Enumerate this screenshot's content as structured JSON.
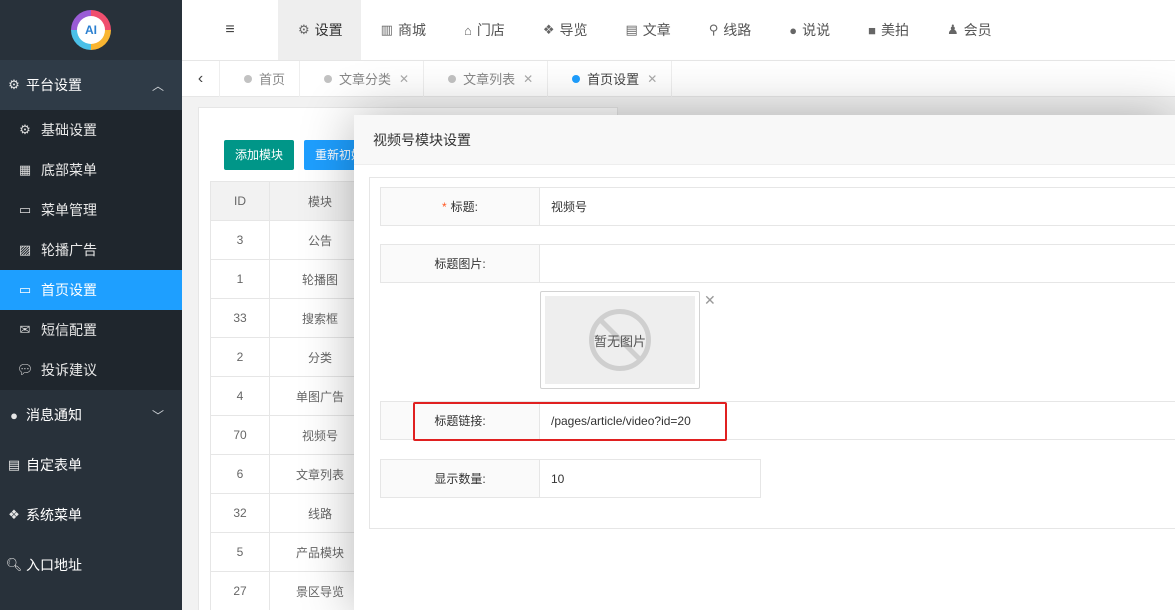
{
  "logo": {
    "text": "AI"
  },
  "sidebar": {
    "groups": [
      {
        "label": "平台设置",
        "icon": "gear-icon",
        "glyph": "⚙",
        "arrow": "︿"
      },
      {
        "label": "消息通知",
        "icon": "chat-bubble-icon",
        "glyph": "●",
        "arrow": "﹀"
      },
      {
        "label": "自定表单",
        "icon": "form-icon",
        "glyph": "▤"
      },
      {
        "label": "系统菜单",
        "icon": "cubes-icon",
        "glyph": "❖"
      },
      {
        "label": "入口地址",
        "icon": "search-icon",
        "glyph": "🔍︎"
      }
    ],
    "items": [
      {
        "label": "基础设置",
        "icon": "gear-icon",
        "glyph": "⚙"
      },
      {
        "label": "底部菜单",
        "icon": "grid-icon",
        "glyph": "▦"
      },
      {
        "label": "菜单管理",
        "icon": "monitor-icon",
        "glyph": "▭"
      },
      {
        "label": "轮播广告",
        "icon": "image-icon",
        "glyph": "▨"
      },
      {
        "label": "首页设置",
        "icon": "monitor-icon",
        "glyph": "▭"
      },
      {
        "label": "短信配置",
        "icon": "envelope-icon",
        "glyph": "✉"
      },
      {
        "label": "投诉建议",
        "icon": "comment-icon",
        "glyph": "💬︎"
      }
    ]
  },
  "topnav": {
    "menu_glyph": "≡",
    "items": [
      {
        "label": "设置",
        "icon": "cogs-icon",
        "glyph": "⚙"
      },
      {
        "label": "商城",
        "icon": "shop-icon",
        "glyph": "▥"
      },
      {
        "label": "门店",
        "icon": "building-icon",
        "glyph": "⌂"
      },
      {
        "label": "导览",
        "icon": "cubes-icon",
        "glyph": "❖"
      },
      {
        "label": "文章",
        "icon": "newspaper-icon",
        "glyph": "▤"
      },
      {
        "label": "线路",
        "icon": "route-icon",
        "glyph": "⚲"
      },
      {
        "label": "说说",
        "icon": "wechat-icon",
        "glyph": "●"
      },
      {
        "label": "美拍",
        "icon": "video-camera-icon",
        "glyph": "■"
      },
      {
        "label": "会员",
        "icon": "user-icon",
        "glyph": "♟"
      }
    ]
  },
  "tabs": {
    "back_glyph": "‹",
    "close_glyph": "✕",
    "items": [
      {
        "label": "首页"
      },
      {
        "label": "文章分类"
      },
      {
        "label": "文章列表"
      },
      {
        "label": "首页设置"
      }
    ]
  },
  "background_list": {
    "add_button": "添加模块",
    "reset_button": "重新初始化",
    "headers": {
      "id": "ID",
      "module": "模块"
    },
    "rows": [
      {
        "id": "3",
        "module": "公告"
      },
      {
        "id": "1",
        "module": "轮播图"
      },
      {
        "id": "33",
        "module": "搜索框"
      },
      {
        "id": "2",
        "module": "分类"
      },
      {
        "id": "4",
        "module": "单图广告"
      },
      {
        "id": "70",
        "module": "视频号"
      },
      {
        "id": "6",
        "module": "文章列表"
      },
      {
        "id": "32",
        "module": "线路"
      },
      {
        "id": "5",
        "module": "产品模块"
      },
      {
        "id": "27",
        "module": "景区导览"
      }
    ]
  },
  "modal": {
    "title": "视频号模块设置",
    "required_mark": "*",
    "title_label": "标题:",
    "title_value": "视频号",
    "image_label": "标题图片:",
    "image_placeholder": "暂无图片",
    "remove_glyph": "✕",
    "link_label": "标题链接:",
    "link_value": "/pages/article/video?id=20",
    "count_label": "显示数量:",
    "count_value": "10"
  },
  "colors": {
    "sidebar_bg": "#28313a",
    "active_blue": "#1E9FFF",
    "green_button": "#009688",
    "highlight_red": "#e02020"
  }
}
